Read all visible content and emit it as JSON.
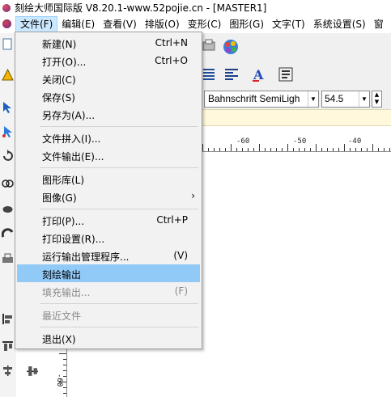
{
  "window": {
    "title": "刻绘大师国际版 V8.20.1-www.52pojie.cn - [MASTER1]"
  },
  "menubar": {
    "items": [
      {
        "label": "文件(F)"
      },
      {
        "label": "编辑(E)"
      },
      {
        "label": "查看(V)"
      },
      {
        "label": "排版(O)"
      },
      {
        "label": "变形(C)"
      },
      {
        "label": "图形(G)"
      },
      {
        "label": "文字(T)"
      },
      {
        "label": "系统设置(S)"
      },
      {
        "label": "窗"
      }
    ]
  },
  "file_menu": {
    "items": [
      {
        "label": "新建(N)",
        "shortcut": "Ctrl+N",
        "enabled": true
      },
      {
        "label": "打开(O)...",
        "shortcut": "Ctrl+O",
        "enabled": true
      },
      {
        "label": "关闭(C)",
        "shortcut": "",
        "enabled": true
      },
      {
        "label": "保存(S)",
        "shortcut": "",
        "enabled": true
      },
      {
        "label": "另存为(A)...",
        "shortcut": "",
        "enabled": true
      },
      {
        "label": "文件拼入(I)...",
        "shortcut": "",
        "enabled": true
      },
      {
        "label": "文件输出(E)...",
        "shortcut": "",
        "enabled": true
      },
      {
        "label": "图形库(L)",
        "shortcut": "",
        "enabled": true
      },
      {
        "label": "图像(G)",
        "shortcut": "",
        "enabled": true,
        "submenu": "›"
      },
      {
        "label": "打印(P)...",
        "shortcut": "Ctrl+P",
        "enabled": true
      },
      {
        "label": "打印设置(R)...",
        "shortcut": "",
        "enabled": true
      },
      {
        "label": "运行输出管理程序...",
        "shortcut": "(V)",
        "enabled": true
      },
      {
        "label": "刻绘输出",
        "shortcut": "",
        "enabled": true,
        "highlighted": true
      },
      {
        "label": "填充输出...",
        "shortcut": "(F)",
        "enabled": false
      },
      {
        "label": "最近文件",
        "shortcut": "",
        "enabled": false
      },
      {
        "label": "退出(X)",
        "shortcut": "",
        "enabled": true
      }
    ]
  },
  "text_toolbar": {
    "font": "Bahnschrift SemiLigh",
    "size": "54.5"
  },
  "ruler": {
    "h_labels": [
      "-60",
      "-50",
      "-40"
    ],
    "v_label": "-60"
  },
  "colors": {
    "menu_highlight": "#91c9f7",
    "menubar_active": "#cce8ff",
    "props_bar": "#fff8dc"
  }
}
